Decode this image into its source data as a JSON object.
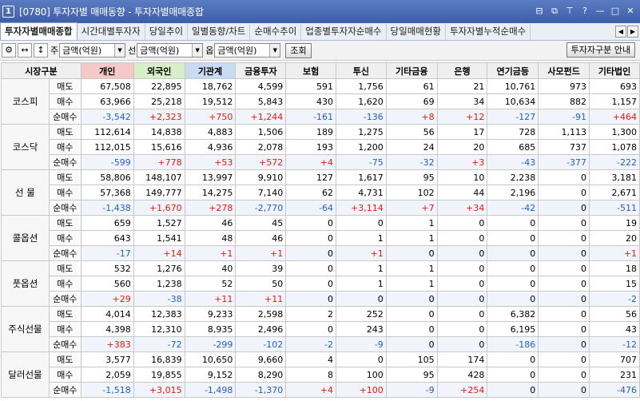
{
  "window": {
    "number": "1",
    "title": "[0780] 투자자별 매매동향 - 투자자별매매종합",
    "controls": [
      "pin-icon",
      "copy-icon",
      "bookmark-icon",
      "help-icon",
      "minimize-icon",
      "maximize-icon",
      "close-icon"
    ],
    "control_glyphs": [
      "⊟",
      "⧉",
      "⊤",
      "?",
      "—",
      "□",
      "✕"
    ]
  },
  "tabs": [
    {
      "label": "투자자별매매종합",
      "active": true
    },
    {
      "label": "시간대별투자자",
      "active": false
    },
    {
      "label": "당일추이",
      "active": false
    },
    {
      "label": "일별동향/차트",
      "active": false
    },
    {
      "label": "순매수추이",
      "active": false
    },
    {
      "label": "업종별투자자순매수",
      "active": false
    },
    {
      "label": "당일매매현황",
      "active": false
    },
    {
      "label": "투자자별누적순매수",
      "active": false
    }
  ],
  "toolbar": {
    "label1": "주",
    "label2": "선",
    "label3": "옵",
    "combo1": "금액(억원)",
    "combo2": "금액(억원)",
    "combo3": "금액(억원)",
    "query_button": "조회",
    "guide_button": "투자자구분 안내"
  },
  "grid": {
    "corner": "시장구분",
    "columns": [
      "개인",
      "외국인",
      "기관계",
      "금융투자",
      "보험",
      "투신",
      "기타금융",
      "은행",
      "연기금등",
      "사모펀드",
      "기타법인"
    ],
    "row_labels": [
      "매도",
      "매수",
      "순매수"
    ],
    "markets": [
      {
        "name": "코스피",
        "rows": [
          [
            "67,508",
            "22,895",
            "18,762",
            "4,599",
            "591",
            "1,756",
            "61",
            "21",
            "10,761",
            "973",
            "693"
          ],
          [
            "63,966",
            "25,218",
            "19,512",
            "5,843",
            "430",
            "1,620",
            "69",
            "34",
            "10,634",
            "882",
            "1,157"
          ],
          [
            "-3,542",
            "+2,323",
            "+750",
            "+1,244",
            "-161",
            "-136",
            "+8",
            "+12",
            "-127",
            "-91",
            "+464"
          ]
        ]
      },
      {
        "name": "코스닥",
        "rows": [
          [
            "112,614",
            "14,838",
            "4,883",
            "1,506",
            "189",
            "1,275",
            "56",
            "17",
            "728",
            "1,113",
            "1,300"
          ],
          [
            "112,015",
            "15,616",
            "4,936",
            "2,078",
            "193",
            "1,200",
            "24",
            "20",
            "685",
            "737",
            "1,078"
          ],
          [
            "-599",
            "+778",
            "+53",
            "+572",
            "+4",
            "-75",
            "-32",
            "+3",
            "-43",
            "-377",
            "-222"
          ]
        ]
      },
      {
        "name": "선 물",
        "rows": [
          [
            "58,806",
            "148,107",
            "13,997",
            "9,910",
            "127",
            "1,617",
            "95",
            "10",
            "2,238",
            "0",
            "3,181"
          ],
          [
            "57,368",
            "149,777",
            "14,275",
            "7,140",
            "62",
            "4,731",
            "102",
            "44",
            "2,196",
            "0",
            "2,671"
          ],
          [
            "-1,438",
            "+1,670",
            "+278",
            "-2,770",
            "-64",
            "+3,114",
            "+7",
            "+34",
            "-42",
            "0",
            "-511"
          ]
        ]
      },
      {
        "name": "콜옵션",
        "rows": [
          [
            "659",
            "1,527",
            "46",
            "45",
            "0",
            "0",
            "1",
            "0",
            "0",
            "0",
            "19"
          ],
          [
            "643",
            "1,541",
            "48",
            "46",
            "0",
            "1",
            "1",
            "0",
            "0",
            "0",
            "20"
          ],
          [
            "-17",
            "+14",
            "+1",
            "+1",
            "0",
            "+1",
            "0",
            "0",
            "0",
            "0",
            "+1"
          ]
        ]
      },
      {
        "name": "풋옵션",
        "rows": [
          [
            "532",
            "1,276",
            "40",
            "39",
            "0",
            "1",
            "1",
            "0",
            "0",
            "0",
            "18"
          ],
          [
            "560",
            "1,238",
            "52",
            "50",
            "0",
            "1",
            "1",
            "0",
            "0",
            "0",
            "15"
          ],
          [
            "+29",
            "-38",
            "+11",
            "+11",
            "0",
            "0",
            "0",
            "0",
            "0",
            "0",
            "-2"
          ]
        ]
      },
      {
        "name": "주식선물",
        "rows": [
          [
            "4,014",
            "12,383",
            "9,233",
            "2,598",
            "2",
            "252",
            "0",
            "0",
            "6,382",
            "0",
            "56"
          ],
          [
            "4,398",
            "12,310",
            "8,935",
            "2,496",
            "0",
            "243",
            "0",
            "0",
            "6,195",
            "0",
            "43"
          ],
          [
            "+383",
            "-72",
            "-299",
            "-102",
            "-2",
            "-9",
            "0",
            "0",
            "-186",
            "0",
            "-12"
          ]
        ]
      },
      {
        "name": "달러선물",
        "rows": [
          [
            "3,577",
            "16,839",
            "10,650",
            "9,660",
            "4",
            "0",
            "105",
            "174",
            "0",
            "0",
            "707"
          ],
          [
            "2,059",
            "19,855",
            "9,152",
            "8,290",
            "8",
            "100",
            "95",
            "428",
            "0",
            "0",
            "231"
          ],
          [
            "-1,518",
            "+3,015",
            "-1,498",
            "-1,370",
            "+4",
            "+100",
            "-9",
            "+254",
            "0",
            "0",
            "-476"
          ]
        ]
      }
    ]
  },
  "colors": {
    "positive": "#e8170b",
    "negative": "#1f5fc5",
    "title_bar": "#4a6bb5"
  }
}
